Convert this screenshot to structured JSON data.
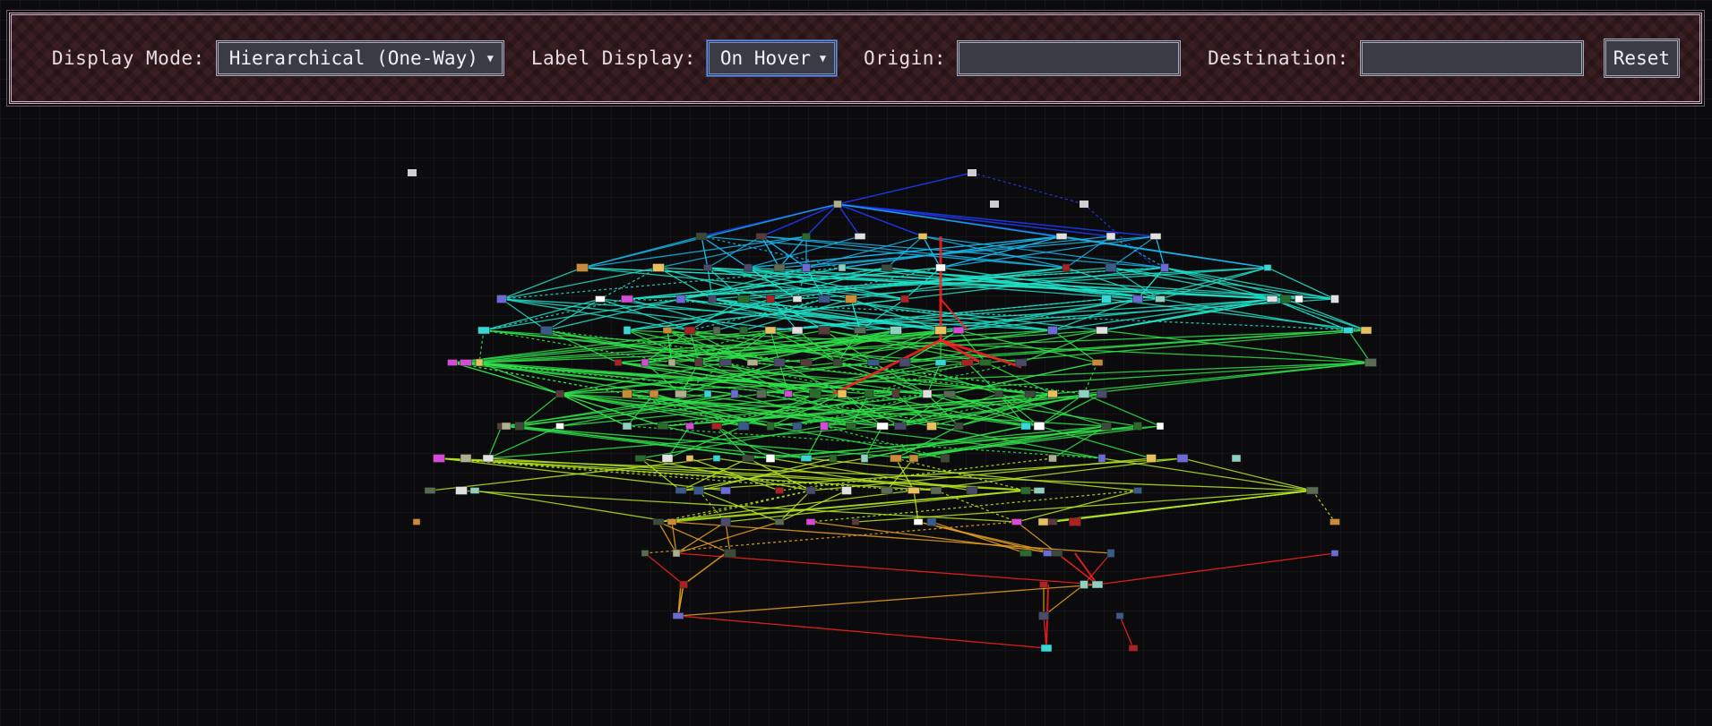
{
  "toolbar": {
    "display_mode_label": "Display Mode:",
    "display_mode_value": "Hierarchical (One-Way)",
    "label_display_label": "Label Display:",
    "label_display_value": "On Hover",
    "origin_label": "Origin:",
    "origin_value": "",
    "destination_label": "Destination:",
    "destination_value": "",
    "reset_label": "Reset"
  },
  "icons": {
    "select_caret": "chevron-down-icon"
  },
  "colors": {
    "toolbar_bg": "#3a1f22",
    "canvas_bg": "#0b0b0d",
    "root_edge": "#1e3cff",
    "upper_edge": "#16b4e6",
    "mid_edge": "#1fe0c8",
    "lower_edge": "#2fe04a",
    "deep_edge": "#b6e61f",
    "leaf_edge": "#e8a020",
    "highlight_path": "#ff2020"
  }
}
